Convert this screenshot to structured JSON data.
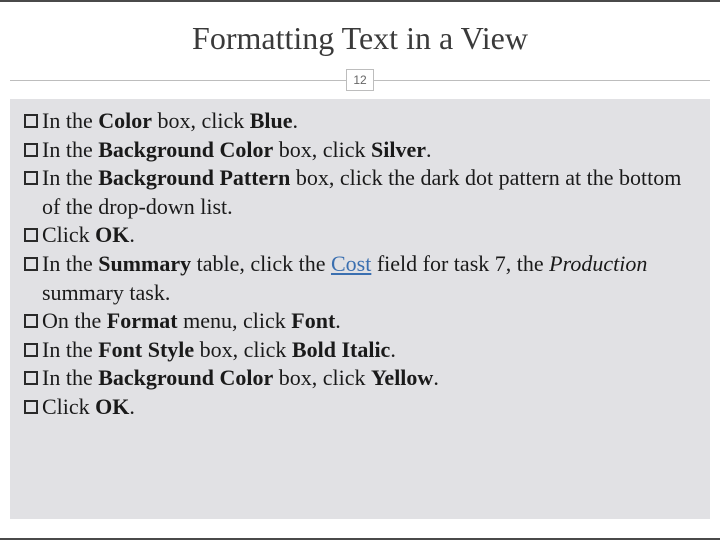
{
  "title": "Formatting Text in a View",
  "page_number": "12",
  "items": [
    {
      "pre": "In the ",
      "b1": "Color",
      "mid1": " box, click ",
      "b2": "Blue",
      "post": "."
    },
    {
      "pre": "In the ",
      "b1": "Background Color",
      "mid1": " box, click ",
      "b2": "Silver",
      "post": "."
    },
    {
      "pre": "In the ",
      "b1": "Background Pattern",
      "mid1": " box, click the dark dot pattern at the bottom of the drop-down list.",
      "b2": "",
      "post": ""
    },
    {
      "pre": "Click ",
      "b1": "OK",
      "mid1": "",
      "b2": "",
      "post": "."
    },
    {
      "pre": "In the ",
      "b1": "Summary",
      "mid1": " table, click the ",
      "link": "Cost",
      "mid2": " field for task 7, the ",
      "ital": "Production",
      "post": " summary task."
    },
    {
      "pre": "On the ",
      "b1": "Format",
      "mid1": " menu, click ",
      "b2": "Font",
      "post": "."
    },
    {
      "pre": "In the ",
      "b1": "Font Style",
      "mid1": " box, click ",
      "b2": "Bold Italic",
      "post": "."
    },
    {
      "pre": "In the ",
      "b1": "Background Color",
      "mid1": " box, click ",
      "b2": "Yellow",
      "post": "."
    },
    {
      "pre": "Click ",
      "b1": "OK",
      "mid1": "",
      "b2": "",
      "post": "."
    }
  ]
}
